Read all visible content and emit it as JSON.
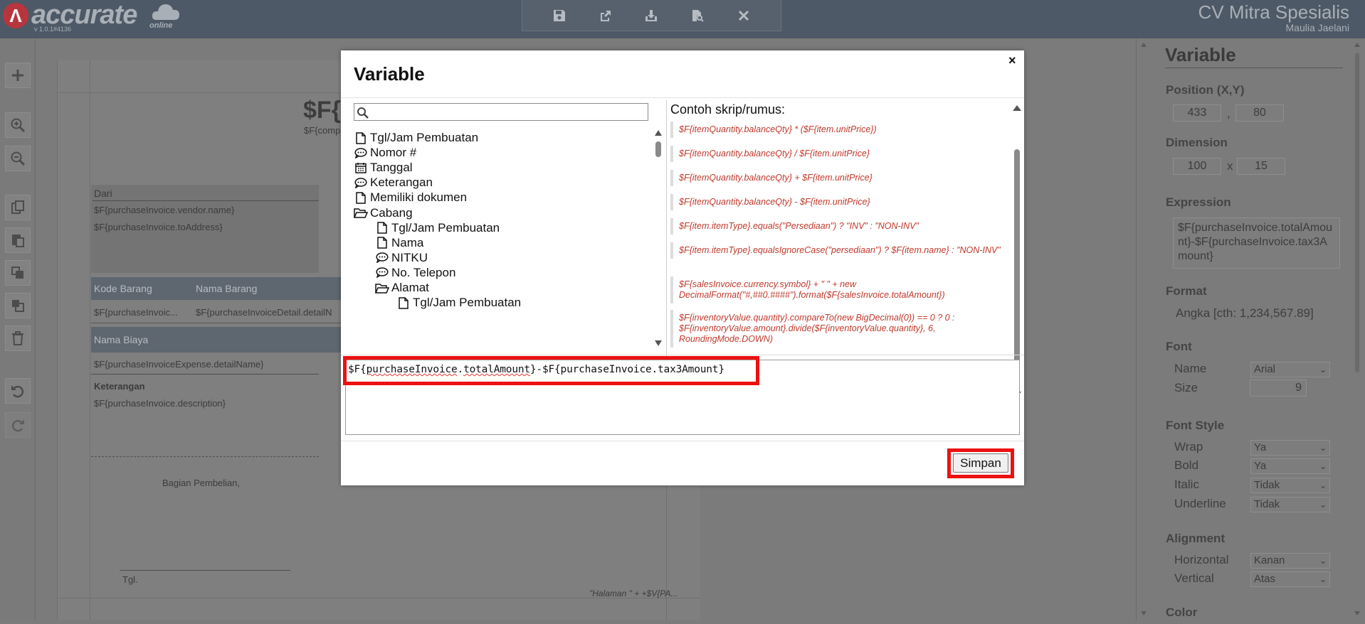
{
  "header": {
    "logo_mark": "Λ",
    "logo_text": "accurate",
    "logo_sub": "online",
    "version": "v 1.0.1#4136",
    "company": "CV Mitra Spesialis",
    "user": "Maulia Jaelani",
    "toolbar_icons": [
      "save-icon",
      "export-icon",
      "download-icon",
      "document-search-icon",
      "close-icon"
    ]
  },
  "left_toolbar": {
    "icons": [
      "add-icon",
      "zoom-in-icon",
      "zoom-out-icon",
      "copy-icon",
      "paste-icon",
      "bring-front-icon",
      "send-back-icon",
      "delete-icon",
      "undo-icon",
      "redo-icon"
    ]
  },
  "page": {
    "title": "$F{",
    "title_sub": "$F{comp",
    "dari_label": "Dari",
    "vendor": "$F{purchaseInvoice.vendor.name}",
    "address": "$F{purchaseInvoice.toAddress}",
    "kode_barang": "Kode Barang",
    "nama_barang": "Nama Barang",
    "detail_code": "$F{purchaseInvoic...",
    "detail_name": "$F{purchaseInvoiceDetail.detailN",
    "nama_biaya": "Nama Biaya",
    "expense": "$F{purchaseInvoiceExpense.detailName}",
    "keterangan": "Keterangan",
    "description": "$F{purchaseInvoice.description}",
    "bagian": "Bagian Pembelian,",
    "tgl": "Tgl.",
    "halaman": "\"Halaman \" +  +$V{PA..."
  },
  "right_panel": {
    "title": "Variable",
    "position_label": "Position (X,Y)",
    "pos_x": "433",
    "pos_sep": ",",
    "pos_y": "80",
    "dimension_label": "Dimension",
    "dim_w": "100",
    "dim_sep": "x",
    "dim_h": "15",
    "expression_label": "Expression",
    "expression": "$F{purchaseInvoice.totalAmount}-$F{purchaseInvoice.tax3Amount}",
    "format_label": "Format",
    "format_value": "Angka [cth: 1,234,567.89]",
    "font_label": "Font",
    "name_label": "Name",
    "name_value": "Arial",
    "size_label": "Size",
    "size_value": "9",
    "font_style_label": "Font Style",
    "wrap_label": "Wrap",
    "wrap_value": "Ya",
    "bold_label": "Bold",
    "bold_value": "Ya",
    "italic_label": "Italic",
    "italic_value": "Tidak",
    "underline_label": "Underline",
    "underline_value": "Tidak",
    "alignment_label": "Alignment",
    "horizontal_label": "Horizontal",
    "horizontal_value": "Kanan",
    "vertical_label": "Vertical",
    "vertical_value": "Atas",
    "color_label": "Color"
  },
  "modal": {
    "title": "Variable",
    "close": "×",
    "search_placeholder": "",
    "tree": [
      {
        "label": "Tgl/Jam Pembuatan",
        "icon": "file-icon",
        "level": 0
      },
      {
        "label": "Nomor #",
        "icon": "comment-icon",
        "level": 0
      },
      {
        "label": "Tanggal",
        "icon": "calendar-icon",
        "level": 0
      },
      {
        "label": "Keterangan",
        "icon": "comment-icon",
        "level": 0
      },
      {
        "label": "Memiliki dokumen",
        "icon": "file-icon",
        "level": 0
      },
      {
        "label": "Cabang",
        "icon": "folder-open-icon",
        "level": 0
      },
      {
        "label": "Tgl/Jam Pembuatan",
        "icon": "file-icon",
        "level": 1
      },
      {
        "label": "Nama",
        "icon": "file-icon",
        "level": 1
      },
      {
        "label": "NITKU",
        "icon": "comment-icon",
        "level": 1
      },
      {
        "label": "No. Telepon",
        "icon": "comment-icon",
        "level": 1
      },
      {
        "label": "Alamat",
        "icon": "folder-open-icon",
        "level": 1
      },
      {
        "label": "Tgl/Jam Pembuatan",
        "icon": "file-icon",
        "level": 2
      }
    ],
    "examples_title": "Contoh skrip/rumus:",
    "examples": [
      "$F{itemQuantity.balanceQty} * ($F{item.unitPrice})",
      "$F{itemQuantity.balanceQty} / $F{item.unitPrice}",
      "$F{itemQuantity.balanceQty} + $F{item.unitPrice}",
      "$F{itemQuantity.balanceQty} - $F{item.unitPrice}",
      "$F{item.itemType}.equals(\"Persediaan\") ? \"INV\" : \"NON-INV\"",
      "$F{item.itemType}.equalsIgnoreCase(\"persediaan\") ? $F{item.name} : \"NON-INV\"",
      "$F{salesInvoice.currency.symbol} + \" \" + new DecimalFormat(\"#,##0.####\").format($F{salesInvoice.totalAmount})",
      "$F{inventoryValue.quantity}.compareTo(new BigDecimal(0)) == 0 ? 0 : $F{inventoryValue.amount}.divide($F{inventoryValue.quantity}, 6, RoundingMode.DOWN)"
    ],
    "expression_part1": "$F{",
    "expression_sq1": "purchaseInvoice",
    "expression_part2": ".",
    "expression_sq2": "totalAmount",
    "expression_part3": "}-$F{purchaseInvoice.tax3Amount}",
    "save_label": "Simpan"
  },
  "colors": {
    "highlight": "#ee1111",
    "example_text": "#c0392b",
    "topbar": "#4d5966"
  }
}
